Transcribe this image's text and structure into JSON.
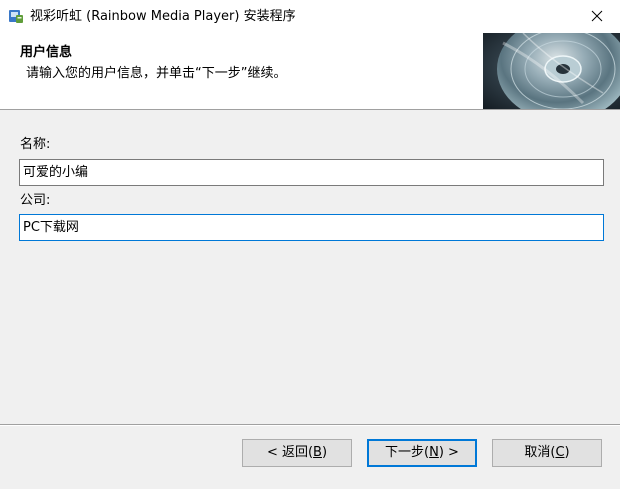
{
  "window": {
    "title": "视彩听虹 (Rainbow Media Player) 安装程序",
    "app_icon": "installer-icon",
    "close_icon": "close-icon"
  },
  "header": {
    "title": "用户信息",
    "subtitle": "请输入您的用户信息，并单击“下一步”继续。",
    "image": "cd-disc-image"
  },
  "form": {
    "name_label": "名称:",
    "name_value": "可爱的小编",
    "company_label": "公司:",
    "company_value": "PC下载网"
  },
  "buttons": {
    "back": {
      "prefix": "< 返回(",
      "key": "B",
      "suffix": ")"
    },
    "next": {
      "prefix": "下一步(",
      "key": "N",
      "suffix": ") >"
    },
    "cancel": {
      "prefix": "取消(",
      "key": "C",
      "suffix": ")"
    }
  },
  "colors": {
    "focus_border": "#0078d7",
    "button_face": "#e1e1e1",
    "dialog_background": "#f0f0f0"
  }
}
